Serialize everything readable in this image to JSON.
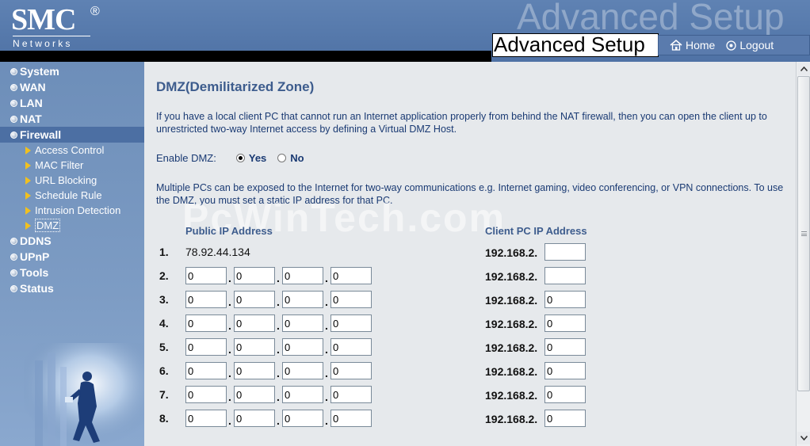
{
  "header": {
    "logo_brand": "SMC",
    "logo_reg": "®",
    "logo_sub": "Networks",
    "ghost_text": "Advanced Setup",
    "title": "Advanced Setup",
    "home_label": "Home",
    "logout_label": "Logout"
  },
  "sidebar": {
    "items": [
      {
        "label": "System"
      },
      {
        "label": "WAN"
      },
      {
        "label": "LAN"
      },
      {
        "label": "NAT"
      },
      {
        "label": "Firewall",
        "active": true
      }
    ],
    "firewall_sub": [
      {
        "label": "Access Control"
      },
      {
        "label": "MAC Filter"
      },
      {
        "label": "URL Blocking"
      },
      {
        "label": "Schedule Rule"
      },
      {
        "label": "Intrusion Detection"
      },
      {
        "label": "DMZ",
        "current": true
      }
    ],
    "items_after": [
      {
        "label": "DDNS"
      },
      {
        "label": "UPnP"
      },
      {
        "label": "Tools"
      },
      {
        "label": "Status"
      }
    ]
  },
  "main": {
    "title": "DMZ(Demilitarized Zone)",
    "description": "If you have a local client PC that cannot run an Internet application properly from behind the NAT firewall, then you can open the client up to unrestricted two-way Internet access by defining a Virtual DMZ Host.",
    "enable_label": "Enable DMZ:",
    "yes_label": "Yes",
    "no_label": "No",
    "enable_value": "Yes",
    "description2": "Multiple PCs can be exposed to the Internet for two-way communications e.g. Internet gaming, video conferencing, or VPN connections. To use the DMZ, you must set a static IP address for that PC.",
    "watermark": "PcWinTech.com",
    "public_header": "Public IP Address",
    "client_header": "Client PC IP Address",
    "client_prefix": "192.168.2.",
    "rows": [
      {
        "num": "1.",
        "public_text": "78.92.44.134",
        "client": ""
      },
      {
        "num": "2.",
        "public": [
          "0",
          "0",
          "0",
          "0"
        ],
        "client": ""
      },
      {
        "num": "3.",
        "public": [
          "0",
          "0",
          "0",
          "0"
        ],
        "client": "0"
      },
      {
        "num": "4.",
        "public": [
          "0",
          "0",
          "0",
          "0"
        ],
        "client": "0"
      },
      {
        "num": "5.",
        "public": [
          "0",
          "0",
          "0",
          "0"
        ],
        "client": "0"
      },
      {
        "num": "6.",
        "public": [
          "0",
          "0",
          "0",
          "0"
        ],
        "client": "0"
      },
      {
        "num": "7.",
        "public": [
          "0",
          "0",
          "0",
          "0"
        ],
        "client": "0"
      },
      {
        "num": "8.",
        "public": [
          "0",
          "0",
          "0",
          "0"
        ],
        "client": "0"
      }
    ]
  }
}
